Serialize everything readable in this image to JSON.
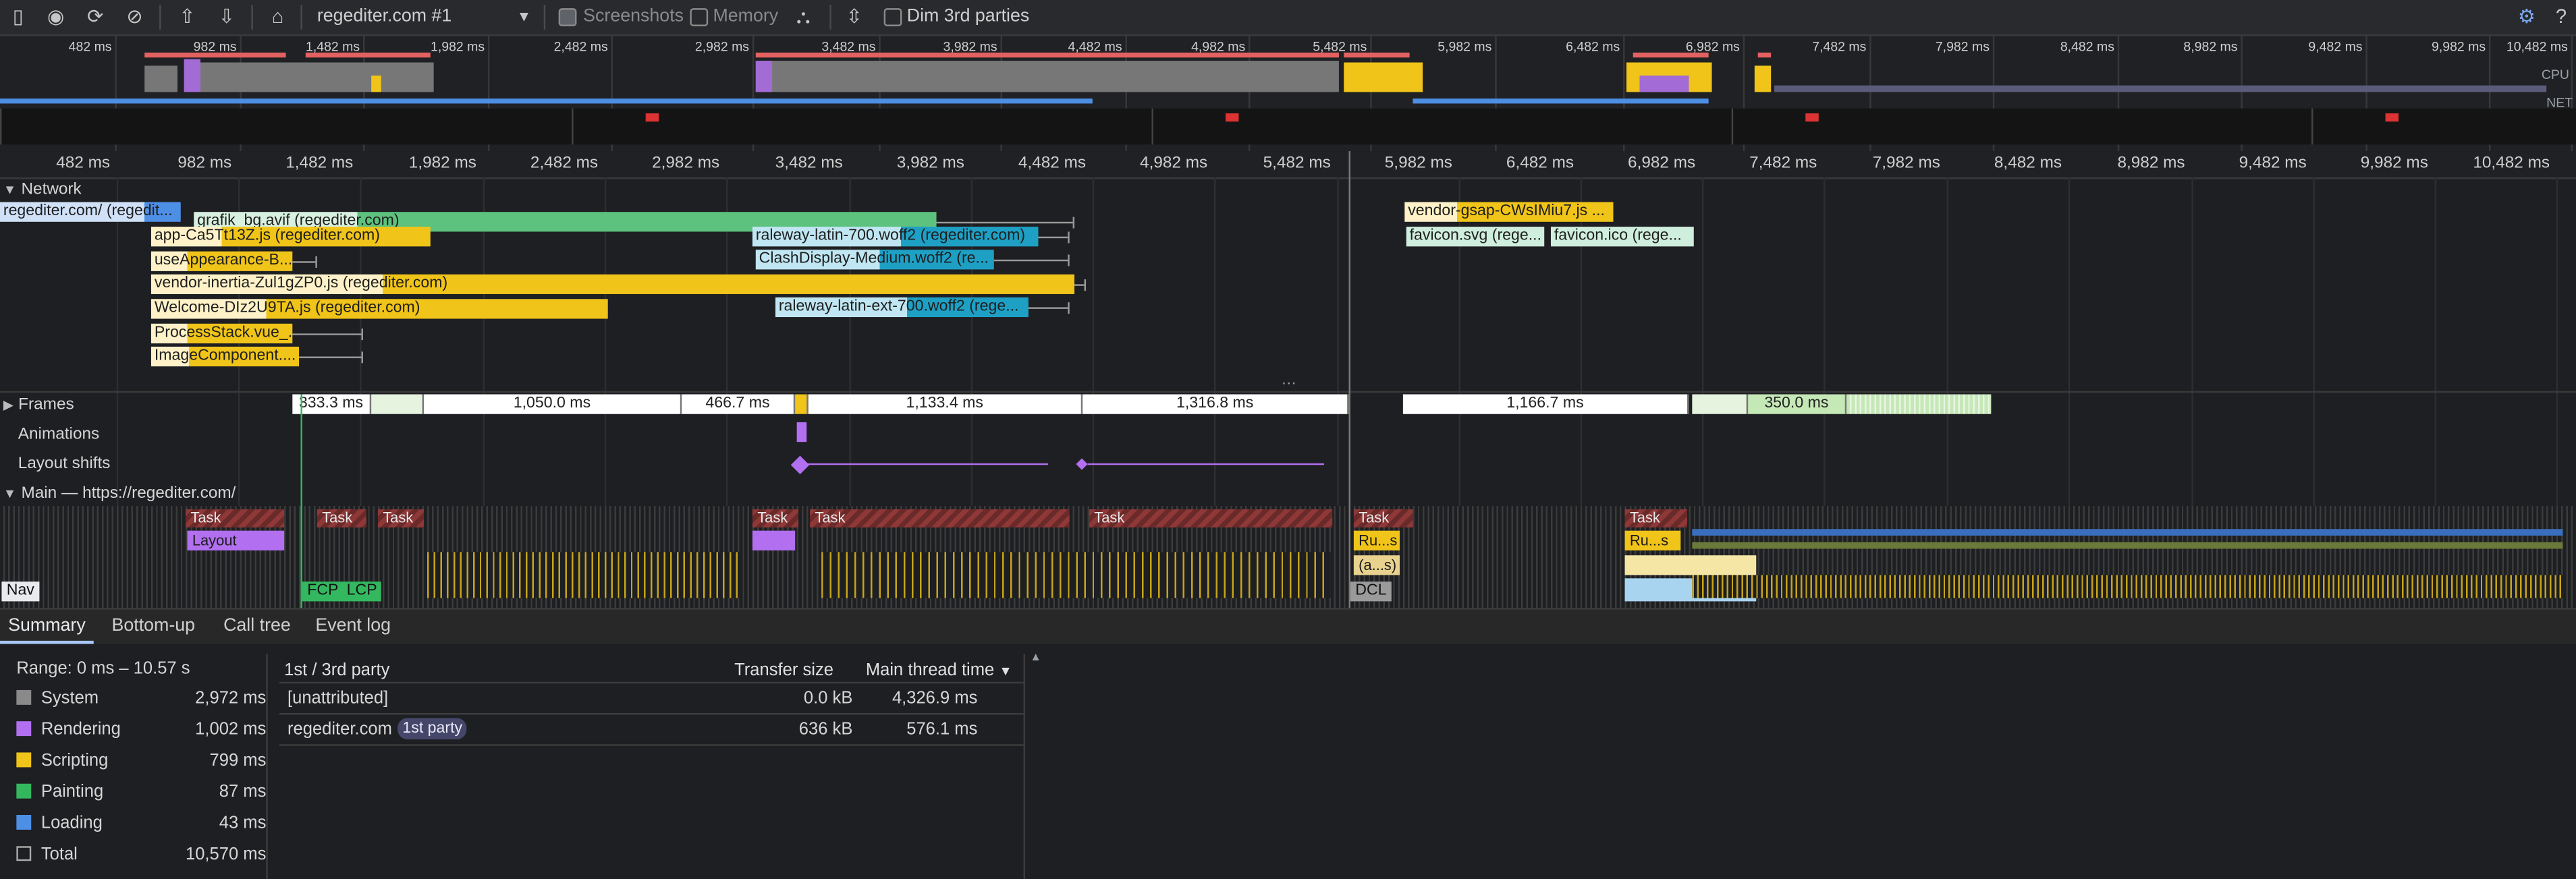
{
  "toolbar": {
    "profile_select": "regediter.com #1",
    "screenshots_label": "Screenshots",
    "memory_label": "Memory",
    "dim_third_parties_label": "Dim 3rd parties"
  },
  "overview": {
    "tick_labels": [
      "482 ms",
      "982 ms",
      "1,482 ms",
      "1,982 ms",
      "2,482 ms",
      "2,982 ms",
      "3,482 ms",
      "3,982 ms",
      "4,482 ms",
      "4,982 ms",
      "5,482 ms",
      "5,982 ms",
      "6,482 ms",
      "6,982 ms",
      "7,482 ms",
      "7,982 ms",
      "8,482 ms",
      "8,982 ms",
      "9,482 ms",
      "9,982 ms",
      "10,482 ms"
    ],
    "cpu_label": "CPU",
    "net_label": "NET"
  },
  "ruler": {
    "tick_labels": [
      "482 ms",
      "982 ms",
      "1,482 ms",
      "1,982 ms",
      "2,482 ms",
      "2,982 ms",
      "3,482 ms",
      "3,982 ms",
      "4,482 ms",
      "4,982 ms",
      "5,482 ms",
      "5,982 ms",
      "6,482 ms",
      "6,982 ms",
      "7,482 ms",
      "7,982 ms",
      "8,482 ms",
      "8,982 ms",
      "9,482 ms",
      "9,982 ms",
      "10,482 ms"
    ]
  },
  "network": {
    "label": "Network",
    "requests": [
      {
        "text": "regediter.com/ (regedit...",
        "color": "#4e8fe6"
      },
      {
        "text": "grafik_bg.avif (regediter.com)",
        "color": "#5cc27e"
      },
      {
        "text": "app-Ca5Tt13Z.js (regediter.com)",
        "color": "#f0c419"
      },
      {
        "text": "useAppearance-B...",
        "color": "#f0c419"
      },
      {
        "text": "vendor-inertia-Zul1gZP0.js (regediter.com)",
        "color": "#f0c419"
      },
      {
        "text": "Welcome-DIz2U9TA.js (regediter.com)",
        "color": "#f0c419"
      },
      {
        "text": "ProcessStack.vue_...",
        "color": "#f0c419"
      },
      {
        "text": "ImageComponent....",
        "color": "#f0c419"
      },
      {
        "text": "raleway-latin-700.woff2 (regediter.com)",
        "color": "#1ea0c5"
      },
      {
        "text": "ClashDisplay-Medium.woff2 (re...",
        "color": "#1ea0c5"
      },
      {
        "text": "raleway-latin-ext-700.woff2 (rege...",
        "color": "#1ea0c5"
      },
      {
        "text": "vendor-gsap-CWsIMiu7.js ...",
        "color": "#f0c419"
      },
      {
        "text": "favicon.svg (rege...",
        "color": "#cfeedd"
      },
      {
        "text": "favicon.ico (rege...",
        "color": "#cfeedd"
      }
    ]
  },
  "frames": {
    "label": "Frames",
    "cells": [
      "333.3 ms",
      "1,050.0 ms",
      "466.7 ms",
      "1,133.4 ms",
      "1,316.8 ms",
      "1,166.7 ms",
      "350.0 ms"
    ]
  },
  "animations": {
    "label": "Animations"
  },
  "layout_shifts": {
    "label": "Layout shifts"
  },
  "main": {
    "label": "Main — https://regediter.com/",
    "task_label": "Task",
    "layout_label": "Layout",
    "run_label": "Ru...s",
    "anon_label": "(a...s)",
    "nav_label": "Nav",
    "fcp_label": "FCP",
    "lcp_label": "LCP",
    "dcl_label": "DCL"
  },
  "bottom_tabs": [
    "Summary",
    "Bottom-up",
    "Call tree",
    "Event log"
  ],
  "summary": {
    "range": "Range: 0 ms – 10.57 s",
    "categories": [
      {
        "name": "System",
        "value": "2,972 ms",
        "color": "#8a8a8a"
      },
      {
        "name": "Rendering",
        "value": "1,002 ms",
        "color": "#b26ff0"
      },
      {
        "name": "Scripting",
        "value": "799 ms",
        "color": "#f0c419"
      },
      {
        "name": "Painting",
        "value": "87 ms",
        "color": "#34b85f"
      },
      {
        "name": "Loading",
        "value": "43 ms",
        "color": "#4e8fe6"
      },
      {
        "name": "Total",
        "value": "10,570 ms",
        "color": "#1e1f22"
      }
    ],
    "table": {
      "col_party": "1st / 3rd party",
      "col_transfer": "Transfer size",
      "col_main": "Main thread time",
      "rows": [
        {
          "name": "[unattributed]",
          "badge": "",
          "transfer": "0.0 kB",
          "main": "4,326.9 ms"
        },
        {
          "name": "regediter.com",
          "badge": "1st party",
          "transfer": "636 kB",
          "main": "576.1 ms"
        }
      ]
    }
  }
}
